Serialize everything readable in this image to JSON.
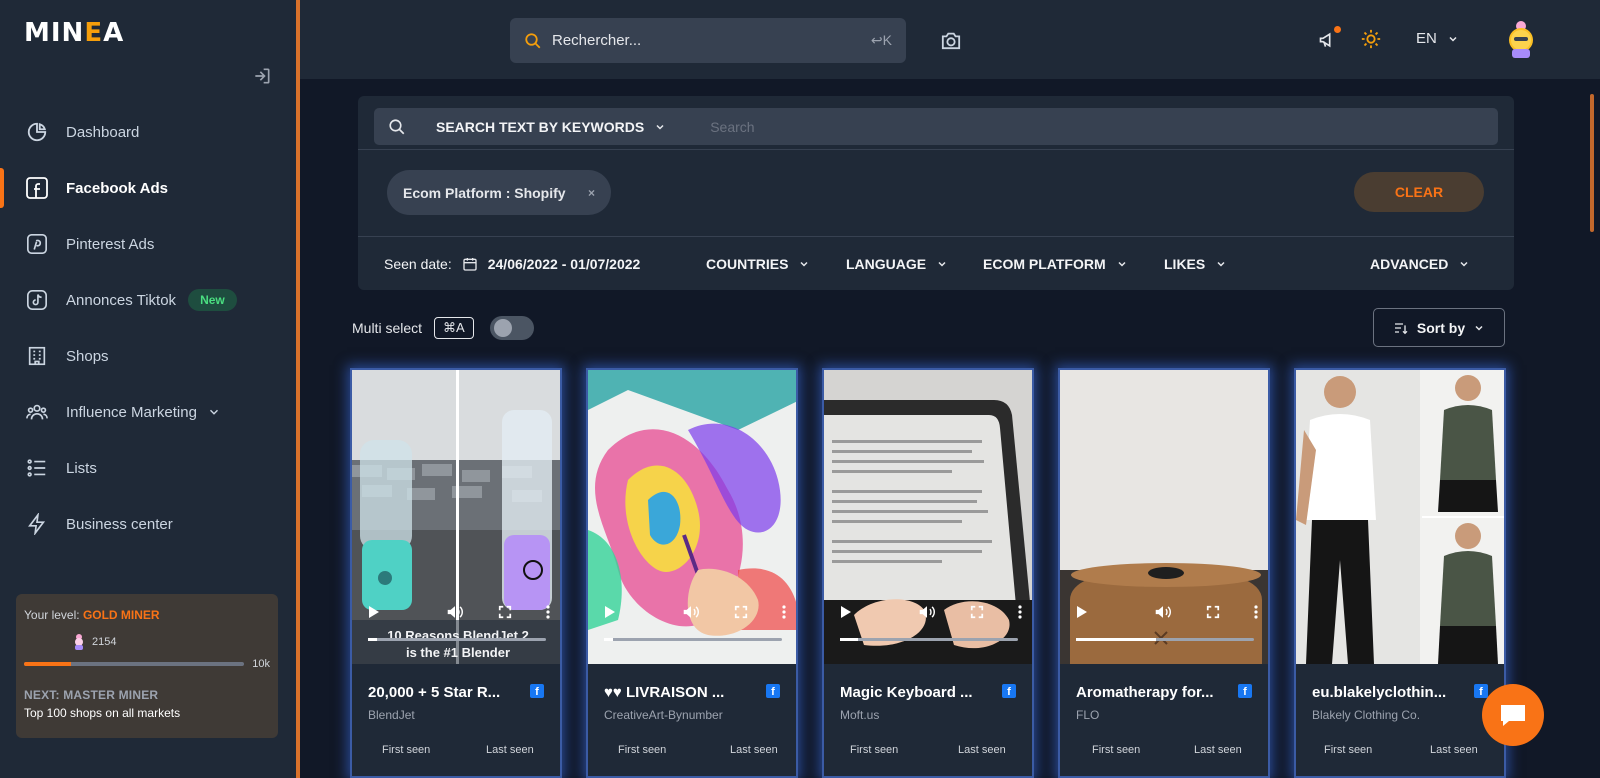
{
  "brand": {
    "logo_pre": "MIN",
    "logo_mid": "E",
    "logo_post": "A"
  },
  "sidebar": {
    "items": [
      {
        "label": "Dashboard"
      },
      {
        "label": "Facebook Ads"
      },
      {
        "label": "Pinterest Ads"
      },
      {
        "label": "Annonces Tiktok",
        "badge": "New"
      },
      {
        "label": "Shops"
      },
      {
        "label": "Influence Marketing"
      },
      {
        "label": "Lists"
      },
      {
        "label": "Business center"
      }
    ],
    "level": {
      "your_level_label": "Your level:",
      "level_name": "GOLD MINER",
      "points": "2154",
      "progress_fraction": 0.2154,
      "max_label": "10k",
      "next_label": "NEXT: MASTER MINER",
      "next_desc": "Top 100 shops on all markets"
    }
  },
  "topbar": {
    "search_placeholder": "Rechercher...",
    "search_shortcut": "↩K",
    "language": "EN"
  },
  "filters": {
    "search_mode": "SEARCH TEXT BY KEYWORDS",
    "search_placeholder": "Search",
    "chip": "Ecom Platform : Shopify",
    "chip_remove": "×",
    "clear_label": "CLEAR",
    "seen_date_label": "Seen date:",
    "seen_date_value": "24/06/2022 - 01/07/2022",
    "countries": "COUNTRIES",
    "language": "LANGUAGE",
    "ecom_platform": "ECOM PLATFORM",
    "likes": "LIKES",
    "advanced": "ADVANCED"
  },
  "toolbar": {
    "multi_select": "Multi select",
    "shortcut": "⌘A",
    "sort_by": "Sort by"
  },
  "cards": [
    {
      "title": "20,000 + 5 Star R...",
      "advertiser": "BlendJet",
      "first_seen": "First seen",
      "last_seen": "Last seen",
      "caption_l1": "10 Reasons BlendJet 2",
      "caption_l2": "is the #1 Blender",
      "progress": 0.05
    },
    {
      "title": "♥♥ LIVRAISON ...",
      "advertiser": "CreativeArt-Bynumber",
      "first_seen": "First seen",
      "last_seen": "Last seen",
      "progress": 0.05
    },
    {
      "title": "Magic Keyboard ...",
      "advertiser": "Moft.us",
      "first_seen": "First seen",
      "last_seen": "Last seen",
      "progress": 0.1
    },
    {
      "title": "Aromatherapy for...",
      "advertiser": "FLO",
      "first_seen": "First seen",
      "last_seen": "Last seen",
      "progress": 0.45
    },
    {
      "title": "eu.blakelyclothin...",
      "advertiser": "Blakely Clothing Co.",
      "first_seen": "First seen",
      "last_seen": "Last seen"
    }
  ],
  "colors": {
    "accent": "#f97316",
    "sidebar_bg": "#1f2937",
    "main_bg": "#111827",
    "card_glow": "#3b6ee6",
    "facebook": "#1877f2"
  }
}
